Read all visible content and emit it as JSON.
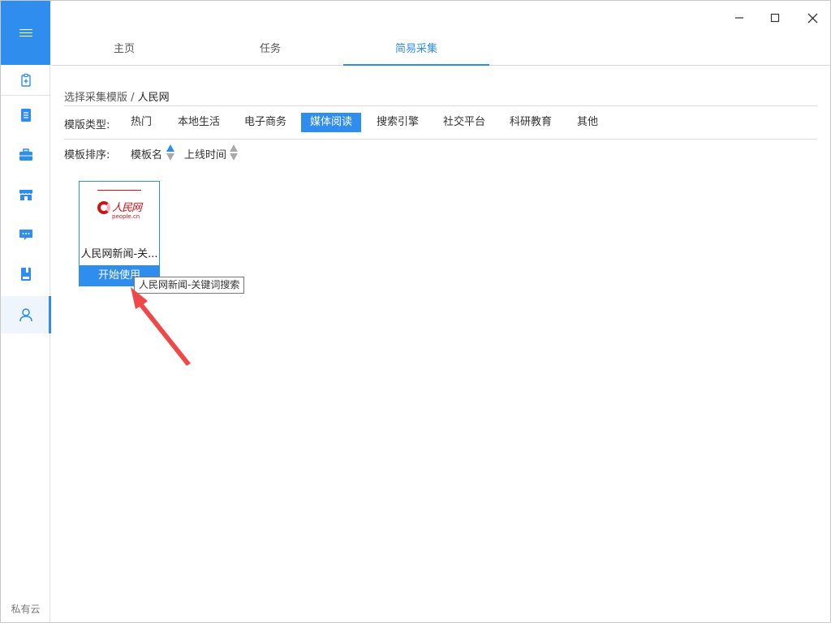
{
  "sidebar": {
    "menu_icon": "hamburger-icon",
    "items": [
      {
        "icon": "new-task-icon"
      },
      {
        "icon": "document-icon"
      },
      {
        "icon": "briefcase-icon"
      },
      {
        "icon": "store-icon"
      },
      {
        "icon": "message-icon"
      },
      {
        "icon": "book-icon"
      },
      {
        "icon": "user-icon"
      }
    ],
    "bottom_label": "私有云"
  },
  "titlebar": {
    "tabs": [
      {
        "label": "主页"
      },
      {
        "label": "任务"
      },
      {
        "label": "简易采集"
      }
    ],
    "active_tab": "简易采集"
  },
  "breadcrumb": {
    "parent": "选择采集模版",
    "separator": " / ",
    "current": "人民网"
  },
  "filter": {
    "type_label": "模版类型:",
    "categories": [
      "热门",
      "本地生活",
      "电子商务",
      "媒体阅读",
      "搜索引擎",
      "社交平台",
      "科研教育",
      "其他"
    ],
    "active_category": "媒体阅读"
  },
  "sort": {
    "label": "模板排序:",
    "options": [
      "模板名",
      "上线时间"
    ]
  },
  "card": {
    "logo_text": "人民网",
    "logo_domain": "people.cn",
    "title": "人民网新闻-关...",
    "button": "开始使用",
    "tooltip": "人民网新闻-关键词搜索"
  },
  "colors": {
    "accent": "#2f8ded",
    "brand_red": "#c8161d"
  }
}
